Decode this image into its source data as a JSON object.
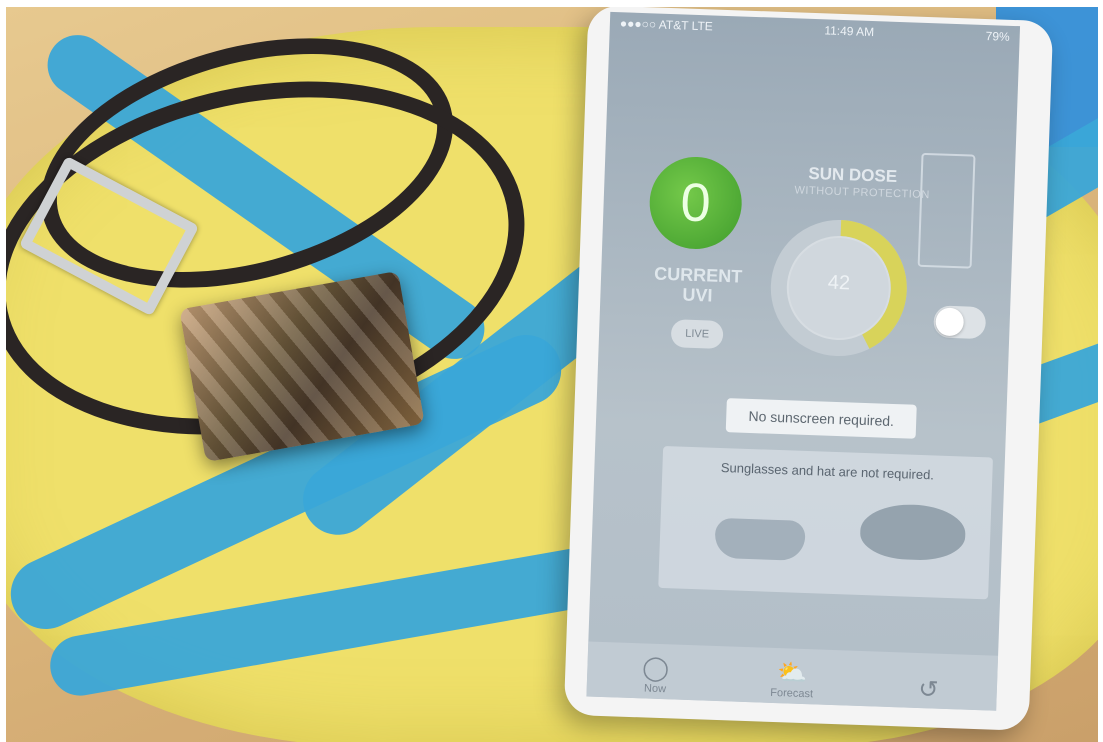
{
  "status_bar": {
    "carrier": "●●●○○ AT&T  LTE",
    "time": "11:49 AM",
    "battery": "79%"
  },
  "current_uvi": {
    "value": "0",
    "label_line1": "CURRENT",
    "label_line2": "UVI",
    "live_label": "LIVE"
  },
  "sun_dose": {
    "title": "SUN DOSE",
    "subtitle": "WITHOUT PROTECTION",
    "value": "42",
    "gauge_fraction": 0.42
  },
  "recommendations": {
    "sunscreen": "No sunscreen required.",
    "accessories": "Sunglasses and hat are not required."
  },
  "tabs": [
    {
      "label": "Now",
      "icon": "circle-icon"
    },
    {
      "label": "Forecast",
      "icon": "cloud-sun-icon"
    },
    {
      "label": "",
      "icon": "history-icon"
    }
  ],
  "colors": {
    "uvi_green": "#4fae35",
    "gauge_yellow": "#d8d35a",
    "gauge_orange": "#e0783c",
    "towel_yellow": "#efe06a",
    "towel_blue": "#3aa6d8"
  }
}
